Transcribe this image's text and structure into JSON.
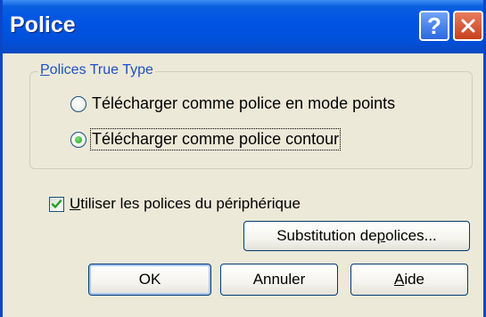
{
  "window": {
    "title": "Police"
  },
  "titlebar_buttons": {
    "help_glyph": "?"
  },
  "group": {
    "legend_key": "P",
    "legend_rest": "olices True Type",
    "radio_bitmap_label": "Télécharger comme police en mode points",
    "radio_bitmap_checked": false,
    "radio_outline_label": "Télécharger comme police contour",
    "radio_outline_checked": true
  },
  "device_fonts": {
    "label_key": "U",
    "label_rest": "tiliser les polices du périphérique",
    "checked": true
  },
  "substitution_button": {
    "label_before": "Substitution de ",
    "label_key": "p",
    "label_after": "olices..."
  },
  "buttons": {
    "ok": "OK",
    "cancel": "Annuler",
    "help_key": "A",
    "help_rest": "ide"
  },
  "colors": {
    "titlebar": "#0054E3",
    "group_legend": "#1E4FC4",
    "dialog_background": "#ECE9D8",
    "radio_check": "#21A121",
    "checkbox_check": "#21A121"
  }
}
